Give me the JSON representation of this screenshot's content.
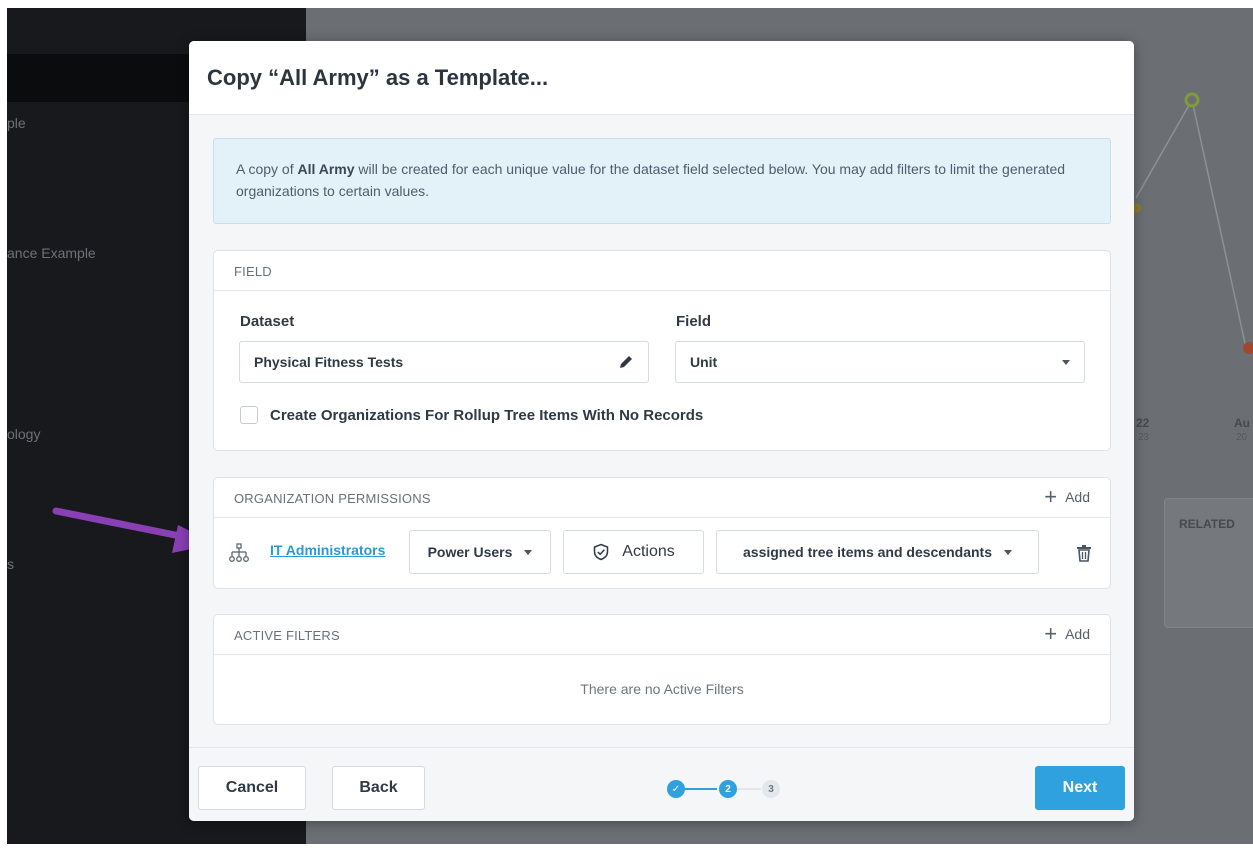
{
  "background": {
    "sidebar_items": [
      "ple",
      "ance Example",
      "ology",
      "s"
    ],
    "chart_dates": [
      {
        "label": "22",
        "sub": "23"
      },
      {
        "label": "Au",
        "sub": "20"
      }
    ],
    "related_label": "RELATED"
  },
  "modal": {
    "title": "Copy “All Army” as a Template...",
    "info": {
      "prefix": "A copy of ",
      "bold": "All Army",
      "suffix": " will be created for each unique value for the dataset field selected below. You may add filters to limit the generated organizations to certain values."
    },
    "field_section": {
      "title": "FIELD",
      "dataset_label": "Dataset",
      "dataset_value": "Physical Fitness Tests",
      "field_label": "Field",
      "field_value": "Unit",
      "checkbox_label": "Create Organizations For Rollup Tree Items With No Records"
    },
    "permissions_section": {
      "title": "ORGANIZATION PERMISSIONS",
      "add_label": "Add",
      "row": {
        "group": "IT Administrators",
        "role": "Power Users",
        "actions": "Actions",
        "scope": "assigned tree items and descendants"
      }
    },
    "filters_section": {
      "title": "ACTIVE FILTERS",
      "add_label": "Add",
      "empty_text": "There are no Active Filters"
    },
    "footer": {
      "cancel": "Cancel",
      "back": "Back",
      "next": "Next",
      "steps": [
        "✓",
        "2",
        "3"
      ]
    }
  },
  "colors": {
    "accent": "#2fa1de",
    "link": "#2f98d4",
    "arrow": "#8a3fb5",
    "info_bg": "#e3f1f9"
  }
}
